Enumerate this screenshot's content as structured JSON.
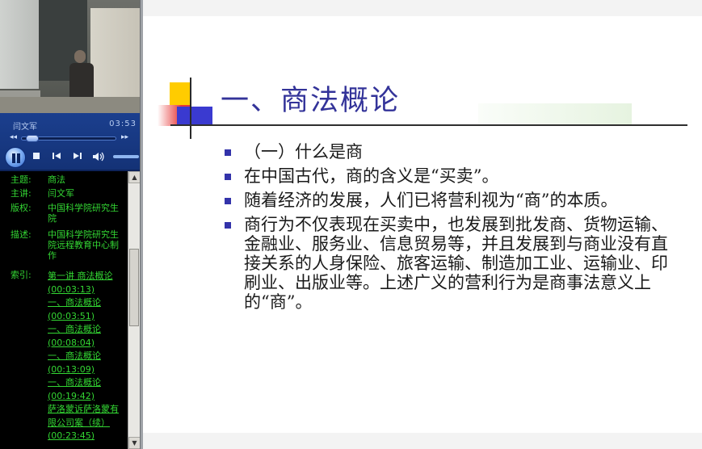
{
  "player": {
    "speaker": "闫文军",
    "time": "03:53",
    "rewind_glyph": "◂◂",
    "forward_glyph": "▸▸"
  },
  "info": {
    "subject_label": "主题:",
    "subject_value": "商法",
    "presenter_label": "主讲:",
    "presenter_value": "闫文军",
    "copyright_label": "版权:",
    "copyright_value": "中国科学院研究生院",
    "description_label": "描述:",
    "description_value": "中国科学院研究生院远程教育中心制作",
    "index_label": "索引:",
    "index_items": [
      "第一讲 商法概论(00:03:13)",
      "一、商法概论(00:03:51)",
      "一、商法概论(00:08:04)",
      "一、商法概论(00:13:09)",
      "一、商法概论(00:19:42)",
      "萨洛蒙诉萨洛蒙有限公司案（续）(00:23:45)"
    ]
  },
  "slide": {
    "title": "一、商法概论",
    "bullets": [
      "（一）什么是商",
      "在中国古代，商的含义是“买卖”。",
      "随着经济的发展，人们已将营利视为“商”的本质。",
      "商行为不仅表现在买卖中，也发展到批发商、货物运输、金融业、服务业、信息贸易等，并且发展到与商业没有直接关系的人身保险、旅客运输、制造加工业、运输业、印刷业、出版业等。上述广义的营利行为是商事法意义上的“商”。"
    ]
  },
  "colors": {
    "title_blue": "#333399",
    "bullet_blue": "#3333aa",
    "link_green": "#33d633",
    "player_blue": "#1b3f8e",
    "deco_yellow": "#ffcc00",
    "deco_red": "#e63a3a",
    "deco_blue": "#3a3ad0"
  },
  "icons": [
    "play-pause-icon",
    "stop-icon",
    "previous-icon",
    "next-icon",
    "volume-icon",
    "scroll-up-icon",
    "scroll-down-icon"
  ]
}
